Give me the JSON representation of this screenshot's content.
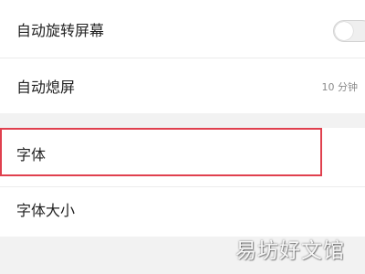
{
  "settings": {
    "auto_rotate": {
      "label": "自动旋转屏幕",
      "toggle_on": false
    },
    "auto_screen_off": {
      "label": "自动熄屏",
      "value": "10 分钟"
    },
    "font": {
      "label": "字体"
    },
    "font_size": {
      "label": "字体大小"
    }
  },
  "colors": {
    "highlight": "#e0404e",
    "background": "#f2f2f2",
    "row_background": "#ffffff"
  },
  "watermark": "易坊好文馆"
}
